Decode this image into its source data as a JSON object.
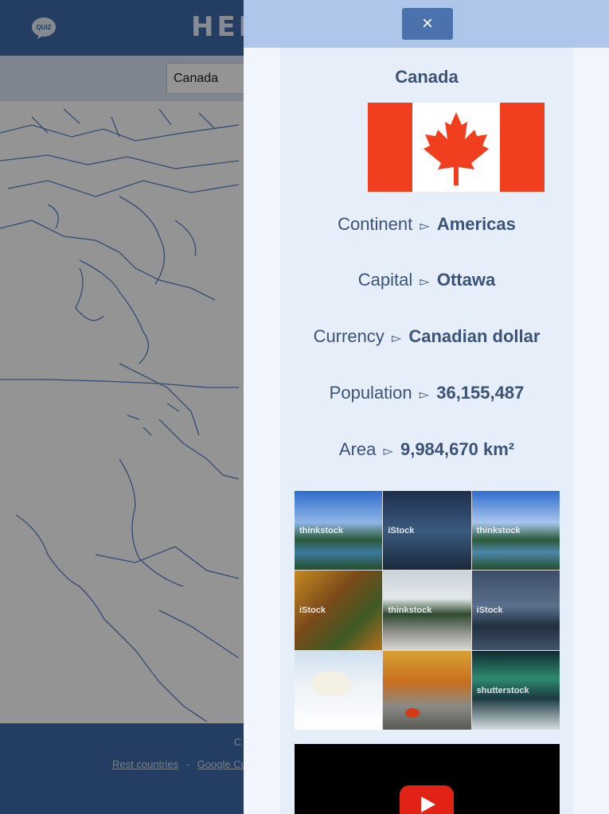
{
  "app": {
    "quiz_label": "QUIZ",
    "brand_text": "HEL",
    "selected_country": "Canada",
    "footer_text": "C",
    "footer_links": [
      "Rest countries",
      "Google Cu"
    ],
    "footer_sep": "-"
  },
  "panel": {
    "close_label": "×",
    "country": "Canada",
    "facts": [
      {
        "label": "Continent",
        "sep": "▻",
        "value": "Americas"
      },
      {
        "label": "Capital",
        "sep": "▻",
        "value": "Ottawa"
      },
      {
        "label": "Currency",
        "sep": "▻",
        "value": "Canadian dollar"
      },
      {
        "label": "Population",
        "sep": "▻",
        "value": "36,155,487"
      },
      {
        "label": "Area",
        "sep": "▻",
        "value": "9,984,670 km²"
      }
    ],
    "gallery_watermarks": [
      "thinkstock",
      "iStock",
      "thinkstock",
      "iStock",
      "thinkstock",
      "iStock",
      "",
      "",
      "shutterstock"
    ]
  },
  "colors": {
    "header_blue": "#3e6aaa",
    "panel_header": "#aec6ea",
    "text_navy": "#3a5377",
    "flag_red": "#f03e1e",
    "youtube_red": "#e32216"
  }
}
